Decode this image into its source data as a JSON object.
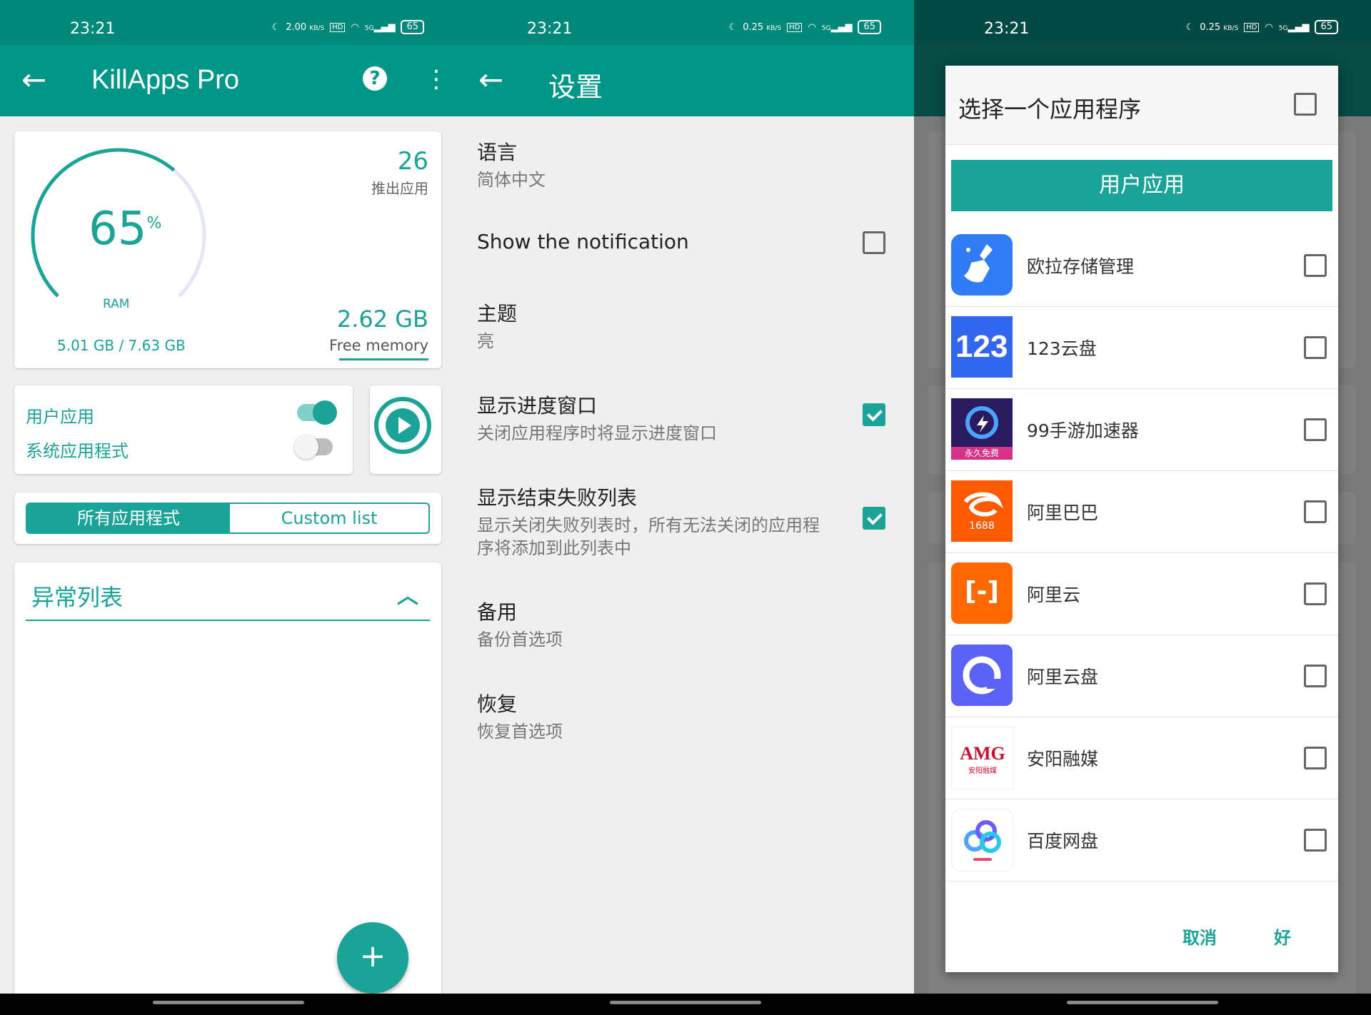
{
  "status": {
    "time": "23:21",
    "p1_speed": "2.00",
    "speed_unit": "KB/S",
    "p23_speed": "0.25",
    "hd": "HD",
    "net": "5G",
    "battery": "65"
  },
  "colors": {
    "primary": "#009688",
    "accent": "#1aa396",
    "status_bar": "#00897b"
  },
  "main": {
    "title": "KillApps Pro",
    "ram_percent": "65",
    "percent_sign": "%",
    "ram_label": "RAM",
    "ram_used": "5.01 GB / 7.63 GB",
    "killed_count": "26",
    "killed_label": "推出应用",
    "free_value": "2.62 GB",
    "free_label": "Free memory",
    "user_apps_label": "用户应用",
    "system_apps_label": "系统应用程式",
    "user_apps_on": true,
    "system_apps_on": false,
    "seg_all": "所有应用程式",
    "seg_custom": "Custom list",
    "exception_title": "异常列表",
    "fab": "+"
  },
  "settings": {
    "title": "设置",
    "items": [
      {
        "title": "语言",
        "sub": "简体中文"
      },
      {
        "title": "Show the notification",
        "sub": "",
        "checked": false
      },
      {
        "title": "主题",
        "sub": "亮"
      },
      {
        "title": "显示进度窗口",
        "sub": "关闭应用程序时将显示进度窗口",
        "checked": true
      },
      {
        "title": "显示结束失败列表",
        "sub": "显示关闭失败列表时，所有无法关闭的应用程",
        "sub2": "序将添加到此列表中",
        "checked": true
      },
      {
        "title": "备用",
        "sub": "备份首选项"
      },
      {
        "title": "恢复",
        "sub": "恢复首选项"
      }
    ]
  },
  "dialog": {
    "title": "选择一个应用程序",
    "tab": "用户应用",
    "apps": [
      {
        "name": "欧拉存储管理",
        "icon": "broom-icon",
        "color": "#2f7cf6"
      },
      {
        "name": "123云盘",
        "icon": "app-123-icon",
        "color": "#3366ee",
        "text": "123"
      },
      {
        "name": "99手游加速器",
        "icon": "app-99-icon",
        "color": "#2a1a5e",
        "text": "永久免费"
      },
      {
        "name": "阿里巴巴",
        "icon": "app-alibaba-icon",
        "color": "#ff5a00",
        "text": "1688"
      },
      {
        "name": "阿里云",
        "icon": "app-aliyun-icon",
        "color": "#ff6a00",
        "text": "[-]"
      },
      {
        "name": "阿里云盘",
        "icon": "app-aliyunpan-icon",
        "color": "#5b62f5"
      },
      {
        "name": "安阳融媒",
        "icon": "app-anyang-icon",
        "color": "#ffffff",
        "text": "AMG",
        "text2": "安阳融媒"
      },
      {
        "name": "百度网盘",
        "icon": "app-baidupan-icon",
        "color": "#ffffff"
      }
    ],
    "cancel": "取消",
    "ok": "好"
  }
}
